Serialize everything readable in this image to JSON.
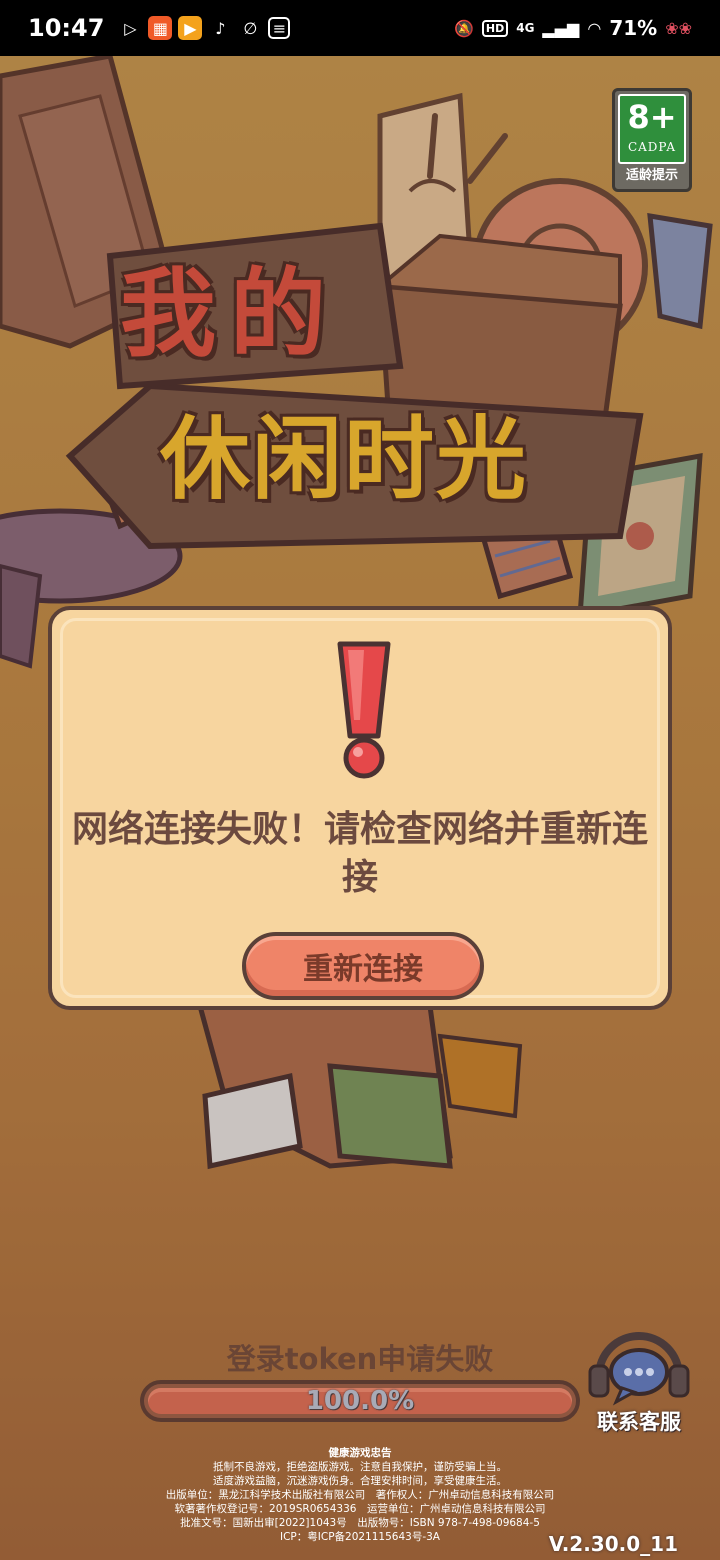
{
  "status_bar": {
    "time": "10:47",
    "battery": "71%",
    "network": "4G",
    "left_icons": [
      "play-icon",
      "app-icon",
      "video-app-icon",
      "tiktok-icon",
      "link-icon",
      "card-icon"
    ],
    "right_icons": [
      "mute-icon",
      "hd-icon",
      "signal-icon",
      "wifi-icon",
      "battery-icon"
    ]
  },
  "game": {
    "logo_line1": "我的",
    "logo_line2": "休闲时光",
    "age_rating": {
      "value": "8+",
      "org": "CADPA",
      "label": "适龄提示",
      "color": "#2f8f3c"
    }
  },
  "dialog": {
    "icon": "exclamation-icon",
    "message": "网络连接失败！请检查网络并重新连接",
    "button_label": "重新连接",
    "button_color": "#ef8468"
  },
  "loading": {
    "status": "登录token申请失败",
    "progress_label": "100.0%",
    "progress_value": 1.0
  },
  "support": {
    "icon": "headset-chat-icon",
    "label": "联系客服"
  },
  "footer": {
    "title": "健康游戏忠告",
    "lines": [
      "抵制不良游戏，拒绝盗版游戏。注意自我保护，谨防受骗上当。",
      "适度游戏益脑，沉迷游戏伤身。合理安排时间，享受健康生活。",
      "出版单位：黑龙江科学技术出版社有限公司　著作权人：广州卓动信息科技有限公司",
      "软著著作权登记号：2019SR0654336　运营单位：广州卓动信息科技有限公司",
      "批准文号：国新出审[2022]1043号　出版物号：ISBN 978-7-498-09684-5",
      "ICP：粤ICP备2021115643号-3A"
    ]
  },
  "version": "V.2.30.0_11"
}
